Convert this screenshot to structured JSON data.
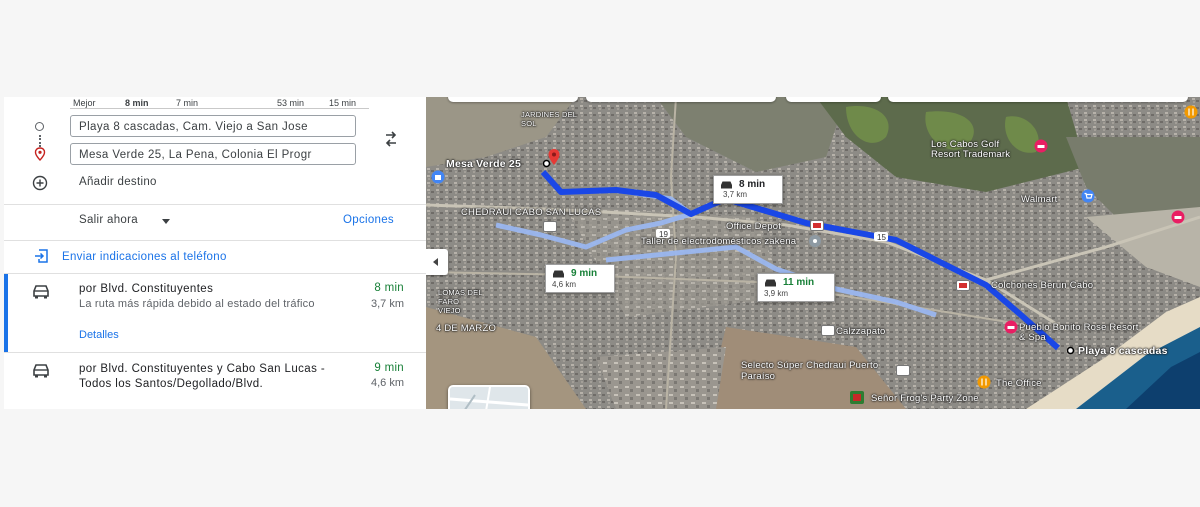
{
  "travel_modes": [
    {
      "label": "Mejor"
    },
    {
      "label": "8 min"
    },
    {
      "label": "7 min"
    },
    {
      "label": "53 min"
    },
    {
      "label": "15 min"
    }
  ],
  "directions": {
    "origin_value": "Playa 8 cascadas, Cam. Viejo a San Jose",
    "destination_value": "Mesa Verde 25, La Pena, Colonia El Progr",
    "add_destination": "Añadir destino"
  },
  "departure": {
    "label": "Salir ahora",
    "options_label": "Opciones"
  },
  "send_to_phone": "Enviar indicaciones al teléfono",
  "routes": [
    {
      "title": "por Blvd. Constituyentes",
      "description": "La ruta más rápida debido al estado del tráfico",
      "time": "8 min",
      "distance": "3,7 km",
      "details_label": "Detalles",
      "selected": true
    },
    {
      "title": "por Blvd. Constituyentes y Cabo San Lucas - Todos los Santos/Degollado/Blvd.",
      "time": "9 min",
      "distance": "4,6 km",
      "selected": false
    }
  ],
  "map": {
    "destination_marker": "Mesa Verde 25",
    "origin_marker": "Playa 8 cascadas",
    "callouts": [
      {
        "time": "8 min",
        "distance": "3,7 km"
      },
      {
        "time": "9 min",
        "distance": "4,6 km"
      },
      {
        "time": "11 min",
        "distance": "3,9 km"
      }
    ],
    "places": [
      {
        "name": "Los Cabos Golf Resort Trademark"
      },
      {
        "name": "Walmart"
      },
      {
        "name": "CHEDRAUI CABO SAN LUCAS"
      },
      {
        "name": "Office Depot"
      },
      {
        "name": "Taller de electrodomésticos zakena"
      },
      {
        "name": "Colchones Berun Cabo"
      },
      {
        "name": "Pueblo Bonito Rose Resort & Spa"
      },
      {
        "name": "Calzzapato"
      },
      {
        "name": "Selecto Súper Chedraui Puerto Paraíso"
      },
      {
        "name": "The Office"
      },
      {
        "name": "Señor Frog's Party Zone"
      },
      {
        "name": "4 DE MARZO"
      },
      {
        "name": "LOMAS DEL FARO VIEJO"
      },
      {
        "name": "JARDINES DEL SOL"
      }
    ],
    "road_numbers": [
      "19",
      "19",
      "15"
    ],
    "colors": {
      "route_primary": "#1a47e6",
      "route_alternate": "#9ab6ef",
      "travel_time_green": "#188038",
      "link_blue": "#1a73e8"
    }
  }
}
